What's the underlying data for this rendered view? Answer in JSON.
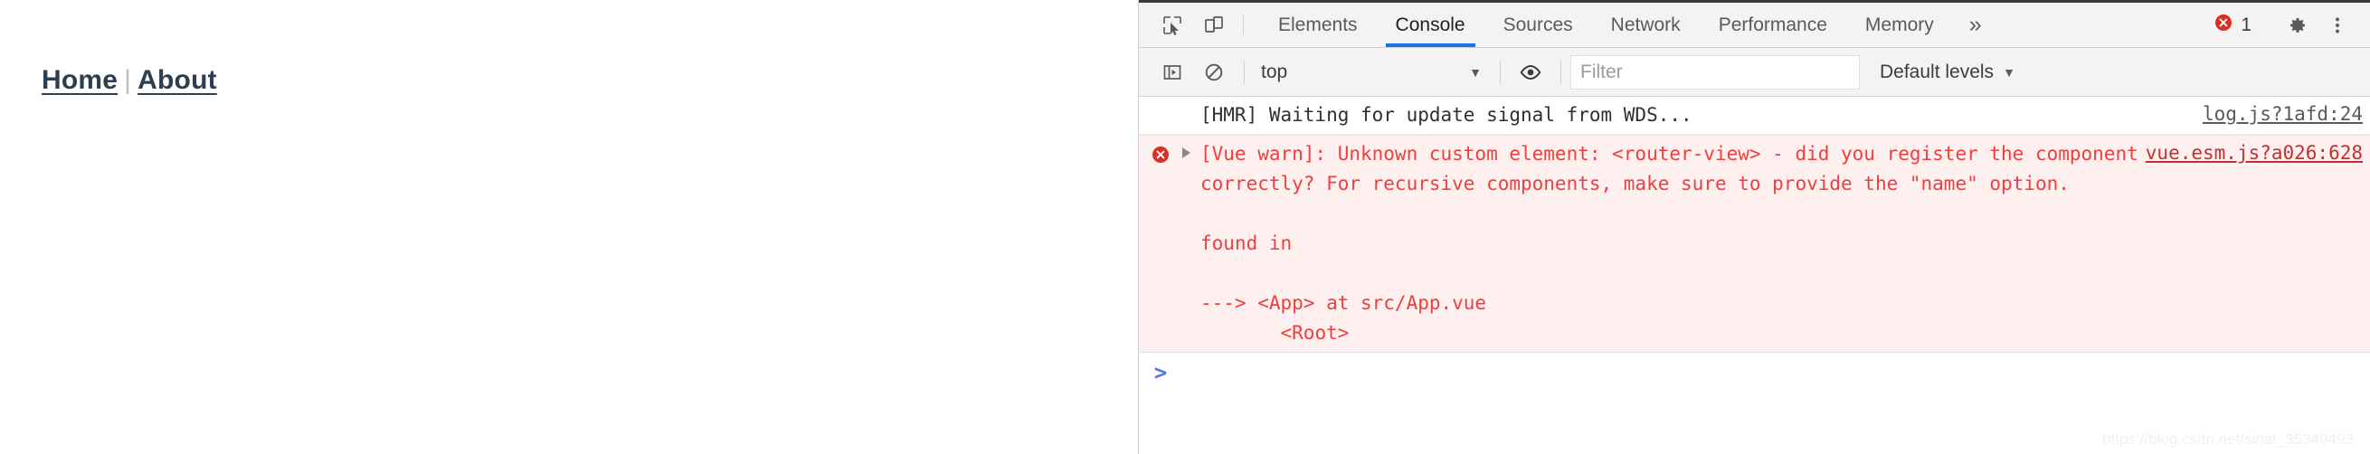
{
  "page": {
    "nav": {
      "home_label": "Home",
      "separator": "|",
      "about_label": "About"
    },
    "link_color": "#2c3e50"
  },
  "devtools": {
    "tabs": [
      {
        "label": "Elements",
        "active": false
      },
      {
        "label": "Console",
        "active": true
      },
      {
        "label": "Sources",
        "active": false
      },
      {
        "label": "Network",
        "active": false
      },
      {
        "label": "Performance",
        "active": false
      },
      {
        "label": "Memory",
        "active": false
      }
    ],
    "more_tabs_label": "»",
    "icons": {
      "inspect": "inspect-cursor-icon",
      "device": "device-toolbar-icon",
      "sidebar": "console-sidebar-icon",
      "clear": "clear-console-icon",
      "eye": "live-expression-eye-icon",
      "settings": "gear-icon",
      "more": "kebab-menu-icon",
      "error": "error-circle-icon"
    },
    "error_badge": {
      "count": "1",
      "color": "#d93025"
    },
    "active_tab_underline_color": "#1a73e8",
    "filterbar": {
      "context_value": "top",
      "context_caret": "▼",
      "filter_placeholder": "Filter",
      "filter_value": "",
      "levels_label": "Default levels",
      "levels_caret": "▼"
    },
    "messages": [
      {
        "level": "log",
        "text": "[HMR] Waiting for update signal from WDS...",
        "source": "log.js?1afd:24",
        "has_disclosure": false
      },
      {
        "level": "error",
        "text": "[Vue warn]: Unknown custom element: <router-view> - did you register the component correctly? For recursive components, make sure to provide the \"name\" option.\n\nfound in\n\n---> <App> at src/App.vue\n       <Root>",
        "source": "vue.esm.js?a026:628",
        "has_disclosure": true
      }
    ],
    "prompt": {
      "chevron": ">",
      "value": ""
    }
  },
  "watermark": "https://blog.csdn.net/sinat_35349493"
}
